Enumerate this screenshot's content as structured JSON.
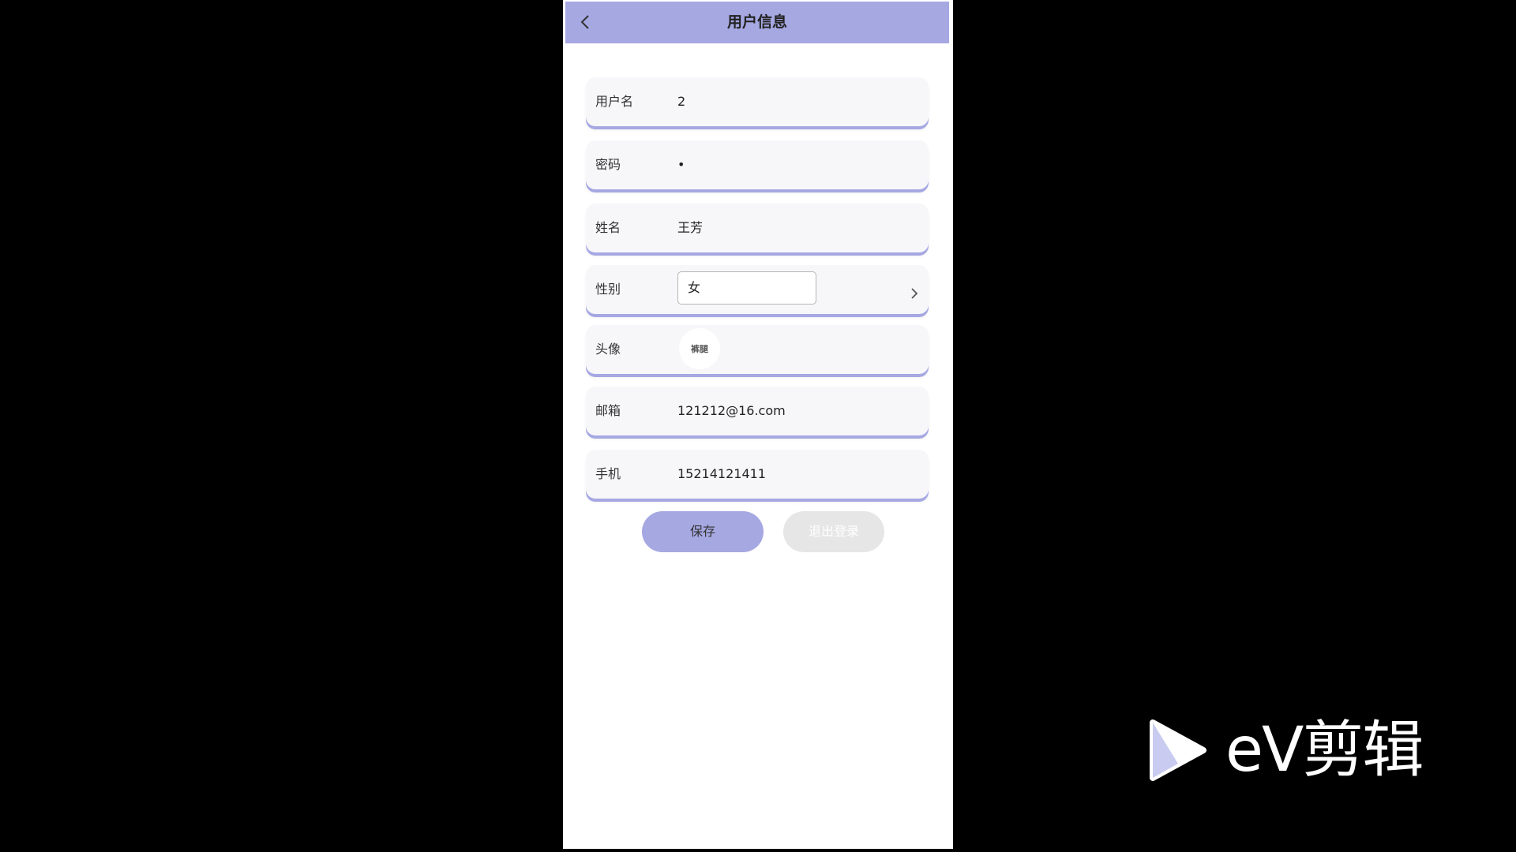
{
  "header": {
    "title": "用户信息",
    "back_icon": "chevron-left-icon"
  },
  "form": {
    "username": {
      "label": "用户名",
      "value": "2"
    },
    "password": {
      "label": "密码",
      "value": "•"
    },
    "name": {
      "label": "姓名",
      "value": "王芳"
    },
    "gender": {
      "label": "性别",
      "value": "女"
    },
    "avatar": {
      "label": "头像",
      "value": "裤腿"
    },
    "email": {
      "label": "邮箱",
      "value": "121212@16.com"
    },
    "phone": {
      "label": "手机",
      "value": "15214121411"
    }
  },
  "buttons": {
    "save": "保存",
    "logout": "退出登录"
  },
  "watermark": {
    "text": "eV剪辑"
  },
  "colors": {
    "accent": "#a6a8e2",
    "row_bg": "#f7f7fa",
    "logout_bg": "#e6e6e6"
  }
}
